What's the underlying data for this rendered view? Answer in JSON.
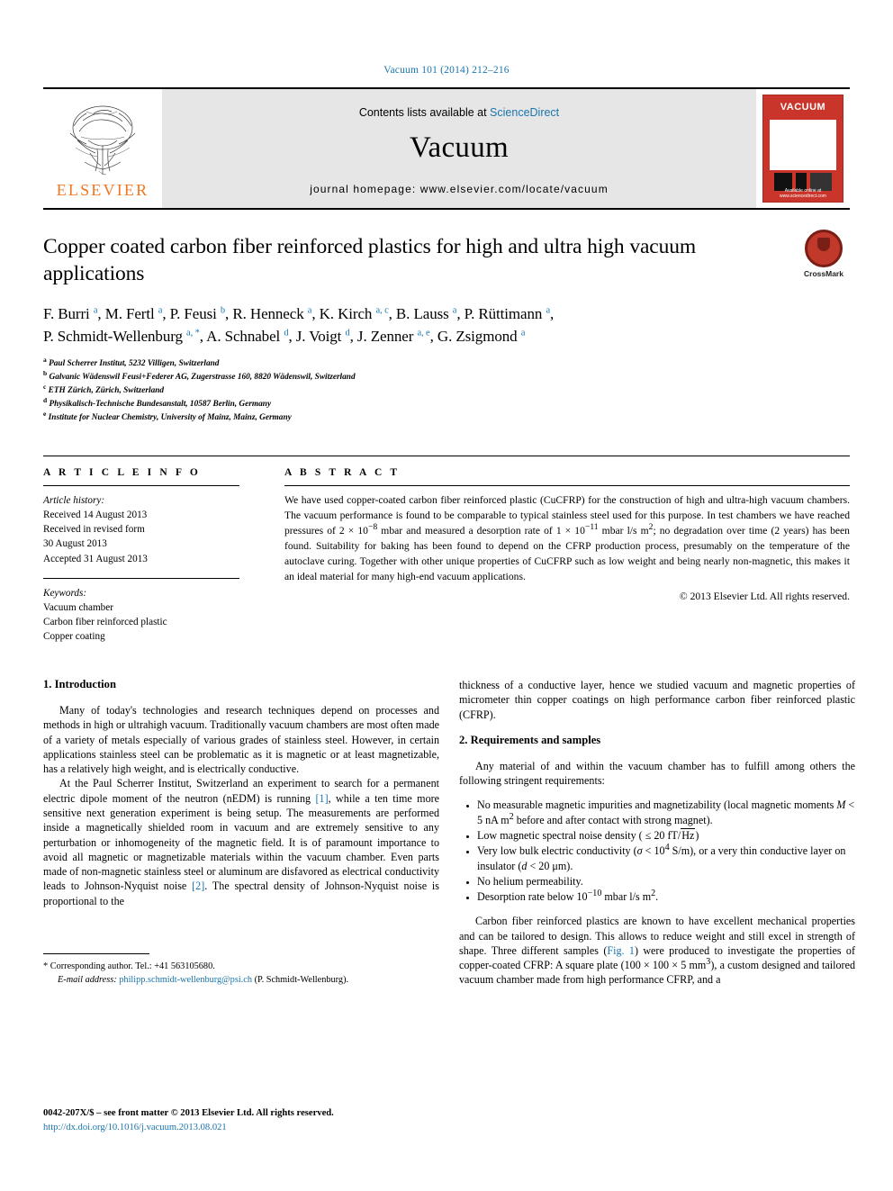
{
  "running_head": "Vacuum 101 (2014) 212–216",
  "masthead": {
    "contents_prefix": "Contents lists available at ",
    "sciencedirect": "ScienceDirect",
    "journal_name": "Vacuum",
    "homepage": "journal homepage: www.elsevier.com/locate/vacuum",
    "publisher_word": "ELSEVIER",
    "cover_title": "VACUUM",
    "cover_footer": "Available online at www.sciencedirect.com"
  },
  "article": {
    "title": "Copper coated carbon fiber reinforced plastics for high and ultra high vacuum applications",
    "crossmark_label": "CrossMark",
    "authors_line1": "F. Burri a, M. Fertl a, P. Feusi b, R. Henneck a, K. Kirch a, c, B. Lauss a, P. Rüttimann a,",
    "authors_line2": "P. Schmidt-Wellenburg a, *, A. Schnabel d, J. Voigt d, J. Zenner a, e, G. Zsigmond a",
    "authors": [
      {
        "name": "F. Burri",
        "aff": "a"
      },
      {
        "name": "M. Fertl",
        "aff": "a"
      },
      {
        "name": "P. Feusi",
        "aff": "b"
      },
      {
        "name": "R. Henneck",
        "aff": "a"
      },
      {
        "name": "K. Kirch",
        "aff": "a, c"
      },
      {
        "name": "B. Lauss",
        "aff": "a"
      },
      {
        "name": "P. Rüttimann",
        "aff": "a"
      },
      {
        "name": "P. Schmidt-Wellenburg",
        "aff": "a, *"
      },
      {
        "name": "A. Schnabel",
        "aff": "d"
      },
      {
        "name": "J. Voigt",
        "aff": "d"
      },
      {
        "name": "J. Zenner",
        "aff": "a, e"
      },
      {
        "name": "G. Zsigmond",
        "aff": "a"
      }
    ],
    "affiliations": [
      {
        "mark": "a",
        "text": "Paul Scherrer Institut, 5232 Villigen, Switzerland"
      },
      {
        "mark": "b",
        "text": "Galvanic Wädenswil Feusi+Federer AG, Zugerstrasse 160, 8820 Wädenswil, Switzerland"
      },
      {
        "mark": "c",
        "text": "ETH Zürich, Zürich, Switzerland"
      },
      {
        "mark": "d",
        "text": "Physikalisch-Technische Bundesanstalt, 10587 Berlin, Germany"
      },
      {
        "mark": "e",
        "text": "Institute for Nuclear Chemistry, University of Mainz, Mainz, Germany"
      }
    ]
  },
  "info": {
    "heading": "A R T I C L E   I N F O",
    "history_label": "Article history:",
    "history": [
      "Received 14 August 2013",
      "Received in revised form",
      "30 August 2013",
      "Accepted 31 August 2013"
    ],
    "keywords_label": "Keywords:",
    "keywords": [
      "Vacuum chamber",
      "Carbon fiber reinforced plastic",
      "Copper coating"
    ]
  },
  "abstract": {
    "heading": "A B S T R A C T",
    "part1": "We have used copper-coated carbon fiber reinforced plastic (CuCFRP) for the construction of high and ultra-high vacuum chambers. The vacuum performance is found to be comparable to typical stainless steel used for this purpose. In test chambers we have reached pressures of 2 × 10",
    "exp1": "−8",
    "part2": " mbar and measured a desorption rate of 1 × 10",
    "exp2": "−11",
    "part3": " mbar l/s m",
    "exp3": "2",
    "part4": "; no degradation over time (2 years) has been found. Suitability for baking has been found to depend on the CFRP production process, presumably on the temperature of the autoclave curing. Together with other unique properties of CuCFRP such as low weight and being nearly non-magnetic, this makes it an ideal material for many high-end vacuum applications.",
    "copyright": "© 2013 Elsevier Ltd. All rights reserved."
  },
  "sections": {
    "intro_heading": "1. Introduction",
    "intro_p1": "Many of today's technologies and research techniques depend on processes and methods in high or ultrahigh vacuum. Traditionally vacuum chambers are most often made of a variety of metals especially of various grades of stainless steel. However, in certain applications stainless steel can be problematic as it is magnetic or at least magnetizable, has a relatively high weight, and is electrically conductive.",
    "intro_p2a": "At the Paul Scherrer Institut, Switzerland an experiment to search for a permanent electric dipole moment of the neutron (nEDM) is running ",
    "ref1": "[1]",
    "intro_p2b": ", while a ten time more sensitive next generation experiment is being setup. The measurements are performed inside a magnetically shielded room in vacuum and are extremely sensitive to any perturbation or inhomogeneity of the magnetic field. It is of paramount importance to avoid all magnetic or magnetizable materials within the vacuum chamber. Even parts made of non-magnetic stainless steel or aluminum are disfavored as electrical conductivity leads to Johnson-Nyquist noise ",
    "ref2": "[2]",
    "intro_p2c": ". The spectral density of Johnson-Nyquist noise is proportional to the thickness of a conductive layer, hence we studied vacuum and magnetic properties of micrometer thin copper coatings on high performance carbon fiber reinforced plastic (CFRP).",
    "req_heading": "2. Requirements and samples",
    "req_intro": "Any material of and within the vacuum chamber has to fulfill among others the following stringent requirements:",
    "req_items": [
      "No measurable magnetic impurities and magnetizability (local magnetic moments M < 5 nA m2 before and after contact with strong magnet).",
      "Low magnetic spectral noise density ( ≤ 20 fT/√Hz)",
      "Very low bulk electric conductivity (σ < 104 S/m), or a very thin conductive layer on insulator (d < 20 μm).",
      "No helium permeability.",
      "Desorption rate below 10−10 mbar l/s m2."
    ],
    "samples_p1a": "Carbon fiber reinforced plastics are known to have excellent mechanical properties and can be tailored to design. This allows to reduce weight and still excel in strength of shape. Three different samples (",
    "figref": "Fig. 1",
    "samples_p1b": ") were produced to investigate the properties of copper-coated CFRP: A square plate (100 × 100 × 5 mm",
    "samples_exp": "3",
    "samples_p1c": "), a custom designed and tailored vacuum chamber made from high performance CFRP, and a"
  },
  "footnote": {
    "corresponding": "* Corresponding author. Tel.: +41 563105680.",
    "email_label": "E-mail address:",
    "email": "philipp.schmidt-wellenburg@psi.ch",
    "email_suffix": "(P. Schmidt-Wellenburg)."
  },
  "page_footer": {
    "issn_line": "0042-207X/$ – see front matter © 2013 Elsevier Ltd. All rights reserved.",
    "doi": "http://dx.doi.org/10.1016/j.vacuum.2013.08.021"
  },
  "colors": {
    "link": "#1a75ad",
    "elsevier_orange": "#ef7622",
    "cover_red": "#c9352a",
    "masthead_grey": "#e6e6e6"
  }
}
